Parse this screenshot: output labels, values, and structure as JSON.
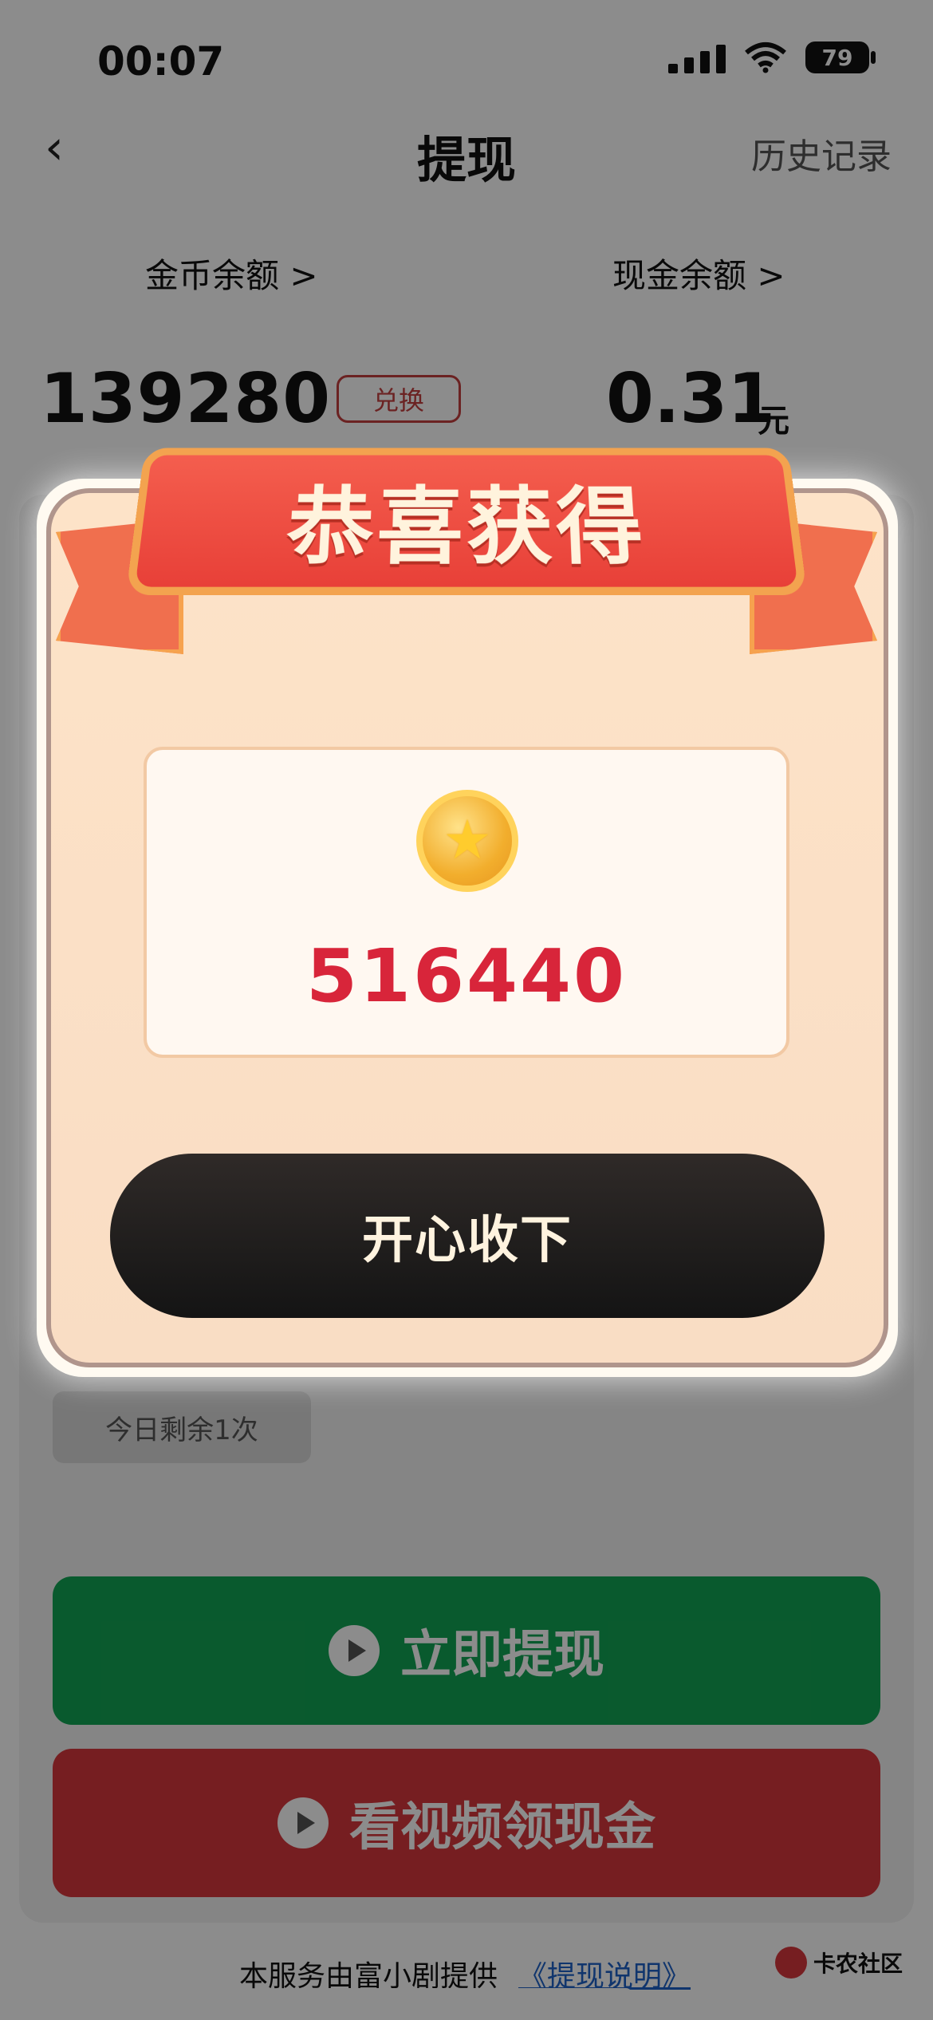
{
  "status_bar": {
    "time": "00:07",
    "battery": "79"
  },
  "nav": {
    "title": "提现",
    "history": "历史记录"
  },
  "balances": {
    "coin_label": "金币余额 >",
    "cash_label": "现金余额 >",
    "coin_value": "139280",
    "exchange": "兑换",
    "cash_value": "0.31",
    "cash_unit": "元"
  },
  "remaining": "今日剩余1次",
  "buttons": {
    "withdraw": "立即提现",
    "watch_video": "看视频领现金"
  },
  "footer": {
    "note": "本服务由富小剧提供",
    "link": "《提现说明》"
  },
  "watermark": "卡农社区",
  "popup": {
    "title": "恭喜获得",
    "amount": "516440",
    "accept": "开心收下"
  },
  "colors": {
    "green": "#12a454",
    "red": "#d7373c",
    "popup_bg": "#fde3c8",
    "ribbon": "#e84038"
  }
}
